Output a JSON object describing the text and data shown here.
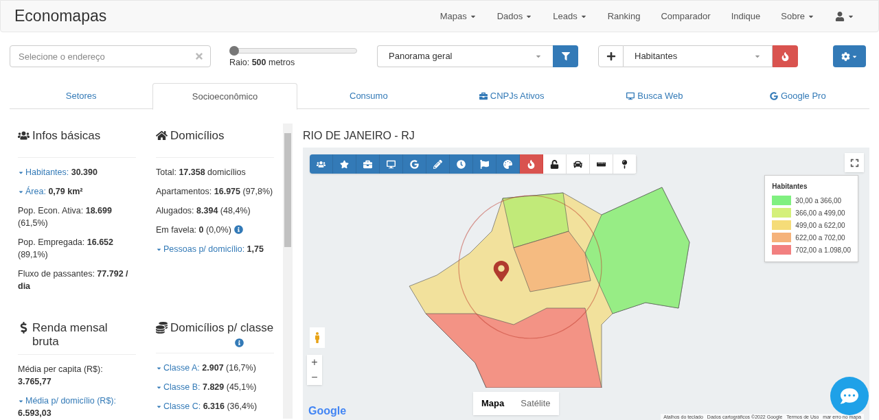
{
  "navbar": {
    "brand": "Economapas",
    "items": [
      {
        "label": "Mapas",
        "dropdown": true
      },
      {
        "label": "Dados",
        "dropdown": true
      },
      {
        "label": "Leads",
        "dropdown": true
      },
      {
        "label": "Ranking",
        "dropdown": false
      },
      {
        "label": "Comparador",
        "dropdown": false
      },
      {
        "label": "Indique",
        "dropdown": false
      },
      {
        "label": "Sobre",
        "dropdown": true
      }
    ]
  },
  "controls": {
    "address": {
      "placeholder": "Selecione o endereço"
    },
    "radius": {
      "level": 0.0,
      "label": "Raio: **500** metros"
    },
    "view_select": {
      "value": "Panorama geral"
    },
    "layer_select": {
      "value": "Habitantes"
    }
  },
  "tabs": [
    {
      "label": "Setores",
      "selected": false
    },
    {
      "label": "Socioeconômico",
      "selected": true
    },
    {
      "label": "Consumo",
      "selected": false
    },
    {
      "label": "CNPJs Ativos",
      "selected": false
    },
    {
      "label": "Busca Web",
      "selected": false
    },
    {
      "label": "Google Pro",
      "selected": false
    }
  ],
  "sections": [
    {
      "title": "Infos básicas",
      "items": [
        {
          "expandable": true,
          "label": "Habitantes:",
          "value": "30.390"
        },
        {
          "expandable": true,
          "label": "Área:",
          "value": "0,79 km²"
        },
        {
          "expandable": false,
          "label": "Pop. Econ. Ativa:",
          "value": "18.699",
          "suffix": "(61,5%)"
        },
        {
          "expandable": false,
          "label": "Pop. Empregada:",
          "value": "16.652",
          "suffix": "(89,1%)"
        },
        {
          "expandable": false,
          "label": "Fluxo de passantes:",
          "value": "77.792 / dia"
        }
      ]
    },
    {
      "title": "Domicílios",
      "items": [
        {
          "expandable": false,
          "label": "Total:",
          "value": "17.358",
          "suffix": "domicílios"
        },
        {
          "expandable": false,
          "label": "Apartamentos:",
          "value": "16.975",
          "suffix": "(97,8%)"
        },
        {
          "expandable": false,
          "label": "Alugados:",
          "value": "8.394",
          "suffix": "(48,4%)"
        },
        {
          "expandable": false,
          "label": "Em favela:",
          "value": "0",
          "suffix": "(0,0%)",
          "info": true
        },
        {
          "expandable": true,
          "label": "Pessoas p/ domicílio:",
          "value": "1,75"
        }
      ]
    },
    {
      "title": "Renda mensal bruta",
      "items": [
        {
          "expandable": false,
          "label": "Média per capita (R$):",
          "value": "3.765,77"
        },
        {
          "expandable": true,
          "label": "Média p/ domicílio (R$):",
          "value": "6.593,03"
        }
      ]
    },
    {
      "title": "Domicílios p/ classe",
      "info": true,
      "items": [
        {
          "expandable": true,
          "label": "Classe A:",
          "value": "2.907",
          "suffix": "(16,7%)"
        },
        {
          "expandable": true,
          "label": "Classe B:",
          "value": "7.829",
          "suffix": "(45,1%)"
        },
        {
          "expandable": true,
          "label": "Classe C:",
          "value": "6.316",
          "suffix": "(36,4%)"
        }
      ]
    }
  ],
  "map": {
    "title": "RIO DE JANEIRO - RJ",
    "toolbar": [
      {
        "kind": "layer",
        "active": false
      },
      {
        "kind": "layer",
        "active": false
      },
      {
        "kind": "layer",
        "active": false
      },
      {
        "kind": "layer",
        "active": false
      },
      {
        "kind": "layer",
        "active": false
      },
      {
        "kind": "layer",
        "active": false
      },
      {
        "kind": "layer",
        "active": false
      },
      {
        "kind": "layer",
        "active": false
      },
      {
        "kind": "layer",
        "active": false
      },
      {
        "kind": "layer",
        "active": true
      },
      {
        "kind": "tool",
        "active": false
      },
      {
        "kind": "tool",
        "active": false
      },
      {
        "kind": "tool",
        "active": false
      },
      {
        "kind": "tool",
        "active": false
      }
    ],
    "legend": {
      "title": "Habitantes",
      "entries": [
        {
          "label": "30,00 a 366,00",
          "color": "#80f080"
        },
        {
          "label": "366,00 a 499,00",
          "color": "#d4f07a"
        },
        {
          "label": "499,00 a 622,00",
          "color": "#f5dc78"
        },
        {
          "label": "622,00 a 702,00",
          "color": "#f5b27a"
        },
        {
          "label": "702,00 a 1.098,00",
          "color": "#f28080"
        }
      ]
    },
    "zoom_controls": [
      "+",
      "−"
    ],
    "map_types": [
      {
        "label": "Mapa",
        "selected": true
      },
      {
        "label": "Satélite",
        "selected": false
      }
    ],
    "logo": "Google",
    "attribution": [
      "Atalhos do teclado",
      "Dados cartográficos ©2022 Google",
      "Termos de Uso",
      "mar erro no mapa"
    ]
  }
}
